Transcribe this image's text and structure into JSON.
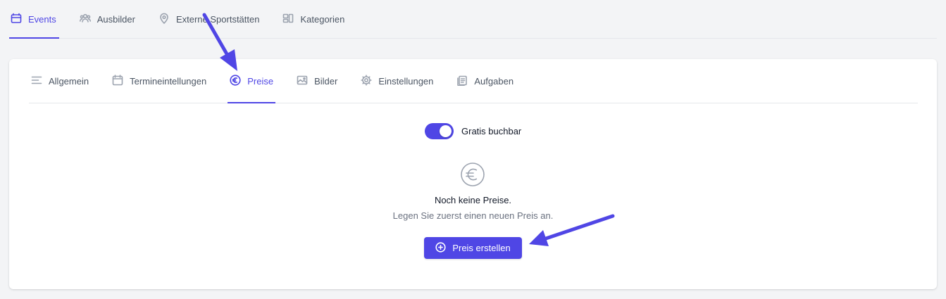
{
  "top_tabs": [
    {
      "label": "Events",
      "icon": "calendar-box-icon",
      "active": true
    },
    {
      "label": "Ausbilder",
      "icon": "users-icon",
      "active": false
    },
    {
      "label": "Externe Sportstätten",
      "icon": "map-pin-icon",
      "active": false
    },
    {
      "label": "Kategorien",
      "icon": "categories-icon",
      "active": false
    }
  ],
  "sub_tabs": [
    {
      "label": "Allgemein",
      "icon": "menu-lines-icon",
      "active": false
    },
    {
      "label": "Termineintellungen",
      "icon": "calendar-icon",
      "active": false
    },
    {
      "label": "Preise",
      "icon": "euro-circle-icon",
      "active": true
    },
    {
      "label": "Bilder",
      "icon": "image-icon",
      "active": false
    },
    {
      "label": "Einstellungen",
      "icon": "gear-icon",
      "active": false
    },
    {
      "label": "Aufgaben",
      "icon": "clipboard-icon",
      "active": false
    }
  ],
  "pricing": {
    "toggle_label": "Gratis buchbar",
    "toggle_on": true,
    "empty_icon": "euro-circle-icon",
    "empty_title": "Noch keine Preise.",
    "empty_subtitle": "Legen Sie zuerst einen neuen Preis an.",
    "create_button_label": "Preis erstellen",
    "create_button_icon": "plus-circle-icon"
  },
  "colors": {
    "accent": "#4f46e5",
    "background": "#f3f4f6",
    "card": "#ffffff",
    "muted_text": "#6b7280",
    "annotation_arrow": "#5046e5"
  }
}
